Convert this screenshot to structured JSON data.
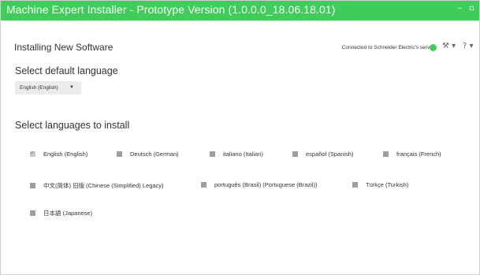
{
  "window": {
    "title": "Machine Expert Installer - Prototype Version (1.0.0.0_18.06.18.01)",
    "minimize_glyph": "–",
    "maximize_glyph": "▫"
  },
  "header": {
    "title": "Installing New Software",
    "status_text": "Connected to Schneider Electric's server",
    "status_color": "#3dcd58",
    "tools_icon": "tools-icon",
    "help_icon": "help-icon",
    "tools_glyph": "⚒ ▾",
    "help_glyph": "? ▾"
  },
  "default_language": {
    "heading": "Select default language",
    "selected": "English (English)",
    "caret": "▼"
  },
  "install_languages": {
    "heading": "Select languages to install",
    "items": [
      {
        "label": "English (English)",
        "checked": true
      },
      {
        "label": "Deutsch (German)",
        "checked": false
      },
      {
        "label": "italiano (Italian)",
        "checked": false
      },
      {
        "label": "español (Spanish)",
        "checked": false
      },
      {
        "label": "français (French)",
        "checked": false
      },
      {
        "label": "中文(简体) 旧版 (Chinese (Simplified) Legacy)",
        "checked": false
      },
      {
        "label": "português (Brasil) (Portuguese (Brazil))",
        "checked": false
      },
      {
        "label": "Türkçe (Turkish)",
        "checked": false
      },
      {
        "label": "日本語 (Japanese)",
        "checked": false
      }
    ]
  },
  "colors": {
    "accent": "#3dcd58",
    "checkbox": "#9e9e9e"
  }
}
